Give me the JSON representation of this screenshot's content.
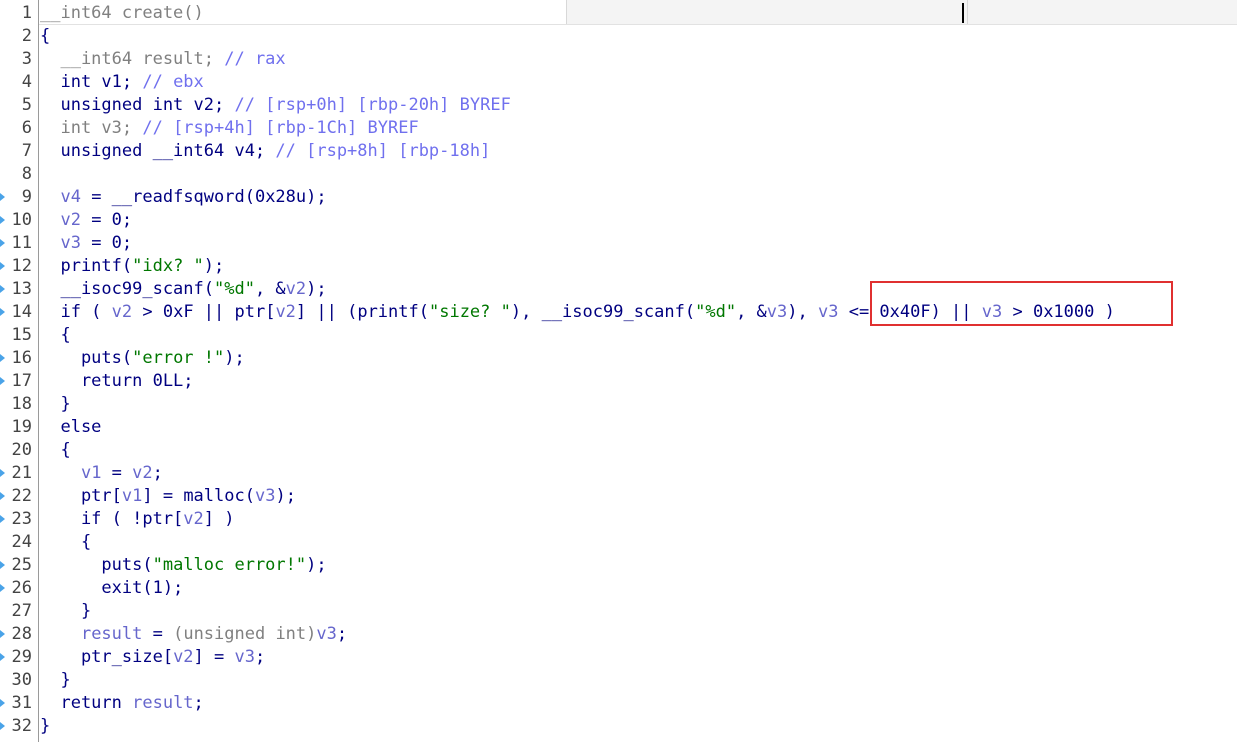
{
  "editor": {
    "lines": [
      {
        "n": " 1",
        "bp": false,
        "tokens": [
          {
            "t": "__int64 create()",
            "c": "g"
          }
        ]
      },
      {
        "n": " 2",
        "bp": false,
        "tokens": [
          {
            "t": "{",
            "c": "k"
          }
        ]
      },
      {
        "n": " 3",
        "bp": false,
        "tokens": [
          {
            "t": "  __int64 result; ",
            "c": "g"
          },
          {
            "t": "// rax",
            "c": "c"
          }
        ]
      },
      {
        "n": " 4",
        "bp": false,
        "tokens": [
          {
            "t": "  int v1; ",
            "c": "k"
          },
          {
            "t": "// ebx",
            "c": "c"
          }
        ]
      },
      {
        "n": " 5",
        "bp": false,
        "tokens": [
          {
            "t": "  unsigned int v2; ",
            "c": "k"
          },
          {
            "t": "// [rsp+0h] [rbp-20h] BYREF",
            "c": "c"
          }
        ]
      },
      {
        "n": " 6",
        "bp": false,
        "tokens": [
          {
            "t": "  int v3; ",
            "c": "g"
          },
          {
            "t": "// [rsp+4h] [rbp-1Ch] BYREF",
            "c": "c"
          }
        ]
      },
      {
        "n": " 7",
        "bp": false,
        "tokens": [
          {
            "t": "  unsigned __int64 v4; ",
            "c": "k"
          },
          {
            "t": "// [rsp+8h] [rbp-18h]",
            "c": "c"
          }
        ]
      },
      {
        "n": " 8",
        "bp": false,
        "tokens": [
          {
            "t": "",
            "c": "k"
          }
        ]
      },
      {
        "n": " 9",
        "bp": true,
        "tokens": [
          {
            "t": "  ",
            "c": "k"
          },
          {
            "t": "v4",
            "c": "v"
          },
          {
            "t": " = __readfsqword(0x28u);",
            "c": "k"
          }
        ]
      },
      {
        "n": "10",
        "bp": true,
        "tokens": [
          {
            "t": "  ",
            "c": "k"
          },
          {
            "t": "v2",
            "c": "v"
          },
          {
            "t": " = 0;",
            "c": "k"
          }
        ]
      },
      {
        "n": "11",
        "bp": true,
        "tokens": [
          {
            "t": "  ",
            "c": "k"
          },
          {
            "t": "v3",
            "c": "v"
          },
          {
            "t": " = 0;",
            "c": "k"
          }
        ]
      },
      {
        "n": "12",
        "bp": true,
        "tokens": [
          {
            "t": "  printf(",
            "c": "k"
          },
          {
            "t": "\"idx? \"",
            "c": "s"
          },
          {
            "t": ");",
            "c": "k"
          }
        ]
      },
      {
        "n": "13",
        "bp": true,
        "tokens": [
          {
            "t": "  __isoc99_scanf(",
            "c": "k"
          },
          {
            "t": "\"%d\"",
            "c": "s"
          },
          {
            "t": ", &",
            "c": "k"
          },
          {
            "t": "v2",
            "c": "v"
          },
          {
            "t": ");",
            "c": "k"
          }
        ]
      },
      {
        "n": "14",
        "bp": true,
        "tokens": [
          {
            "t": "  if ( ",
            "c": "k"
          },
          {
            "t": "v2",
            "c": "v"
          },
          {
            "t": " > 0xF || ptr[",
            "c": "k"
          },
          {
            "t": "v2",
            "c": "v"
          },
          {
            "t": "] || (printf(",
            "c": "k"
          },
          {
            "t": "\"size? \"",
            "c": "s"
          },
          {
            "t": "), __isoc99_scanf(",
            "c": "k"
          },
          {
            "t": "\"%d\"",
            "c": "s"
          },
          {
            "t": ", &",
            "c": "k"
          },
          {
            "t": "v3",
            "c": "v"
          },
          {
            "t": "), ",
            "c": "k"
          },
          {
            "t": "v3",
            "c": "v"
          },
          {
            "t": " <= 0x40F) || ",
            "c": "k"
          },
          {
            "t": "v3",
            "c": "v"
          },
          {
            "t": " > 0x1000 )",
            "c": "k"
          }
        ]
      },
      {
        "n": "15",
        "bp": false,
        "tokens": [
          {
            "t": "  {",
            "c": "k"
          }
        ]
      },
      {
        "n": "16",
        "bp": true,
        "tokens": [
          {
            "t": "    puts(",
            "c": "k"
          },
          {
            "t": "\"error !\"",
            "c": "s"
          },
          {
            "t": ");",
            "c": "k"
          }
        ]
      },
      {
        "n": "17",
        "bp": true,
        "tokens": [
          {
            "t": "    return 0LL;",
            "c": "k"
          }
        ]
      },
      {
        "n": "18",
        "bp": false,
        "tokens": [
          {
            "t": "  }",
            "c": "k"
          }
        ]
      },
      {
        "n": "19",
        "bp": false,
        "tokens": [
          {
            "t": "  else",
            "c": "k"
          }
        ]
      },
      {
        "n": "20",
        "bp": false,
        "tokens": [
          {
            "t": "  {",
            "c": "k"
          }
        ]
      },
      {
        "n": "21",
        "bp": true,
        "tokens": [
          {
            "t": "    ",
            "c": "k"
          },
          {
            "t": "v1",
            "c": "v"
          },
          {
            "t": " = ",
            "c": "k"
          },
          {
            "t": "v2",
            "c": "v"
          },
          {
            "t": ";",
            "c": "k"
          }
        ]
      },
      {
        "n": "22",
        "bp": true,
        "tokens": [
          {
            "t": "    ptr[",
            "c": "k"
          },
          {
            "t": "v1",
            "c": "v"
          },
          {
            "t": "] = malloc(",
            "c": "k"
          },
          {
            "t": "v3",
            "c": "v"
          },
          {
            "t": ");",
            "c": "k"
          }
        ]
      },
      {
        "n": "23",
        "bp": true,
        "tokens": [
          {
            "t": "    if ( !ptr[",
            "c": "k"
          },
          {
            "t": "v2",
            "c": "v"
          },
          {
            "t": "] )",
            "c": "k"
          }
        ]
      },
      {
        "n": "24",
        "bp": false,
        "tokens": [
          {
            "t": "    {",
            "c": "k"
          }
        ]
      },
      {
        "n": "25",
        "bp": true,
        "tokens": [
          {
            "t": "      puts(",
            "c": "k"
          },
          {
            "t": "\"malloc error!\"",
            "c": "s"
          },
          {
            "t": ");",
            "c": "k"
          }
        ]
      },
      {
        "n": "26",
        "bp": true,
        "tokens": [
          {
            "t": "      exit(1);",
            "c": "k"
          }
        ]
      },
      {
        "n": "27",
        "bp": false,
        "tokens": [
          {
            "t": "    }",
            "c": "k"
          }
        ]
      },
      {
        "n": "28",
        "bp": true,
        "tokens": [
          {
            "t": "    ",
            "c": "k"
          },
          {
            "t": "result",
            "c": "v"
          },
          {
            "t": " = ",
            "c": "k"
          },
          {
            "t": "(unsigned int)",
            "c": "g"
          },
          {
            "t": "v3",
            "c": "v"
          },
          {
            "t": ";",
            "c": "k"
          }
        ]
      },
      {
        "n": "29",
        "bp": true,
        "tokens": [
          {
            "t": "    ptr_size[",
            "c": "k"
          },
          {
            "t": "v2",
            "c": "v"
          },
          {
            "t": "] = ",
            "c": "k"
          },
          {
            "t": "v3",
            "c": "v"
          },
          {
            "t": ";",
            "c": "k"
          }
        ]
      },
      {
        "n": "30",
        "bp": false,
        "tokens": [
          {
            "t": "  }",
            "c": "k"
          }
        ]
      },
      {
        "n": "31",
        "bp": true,
        "tokens": [
          {
            "t": "  return ",
            "c": "k"
          },
          {
            "t": "result",
            "c": "v"
          },
          {
            "t": ";",
            "c": "k"
          }
        ]
      },
      {
        "n": "32",
        "bp": true,
        "tokens": [
          {
            "t": "}",
            "c": "k"
          }
        ]
      }
    ]
  }
}
